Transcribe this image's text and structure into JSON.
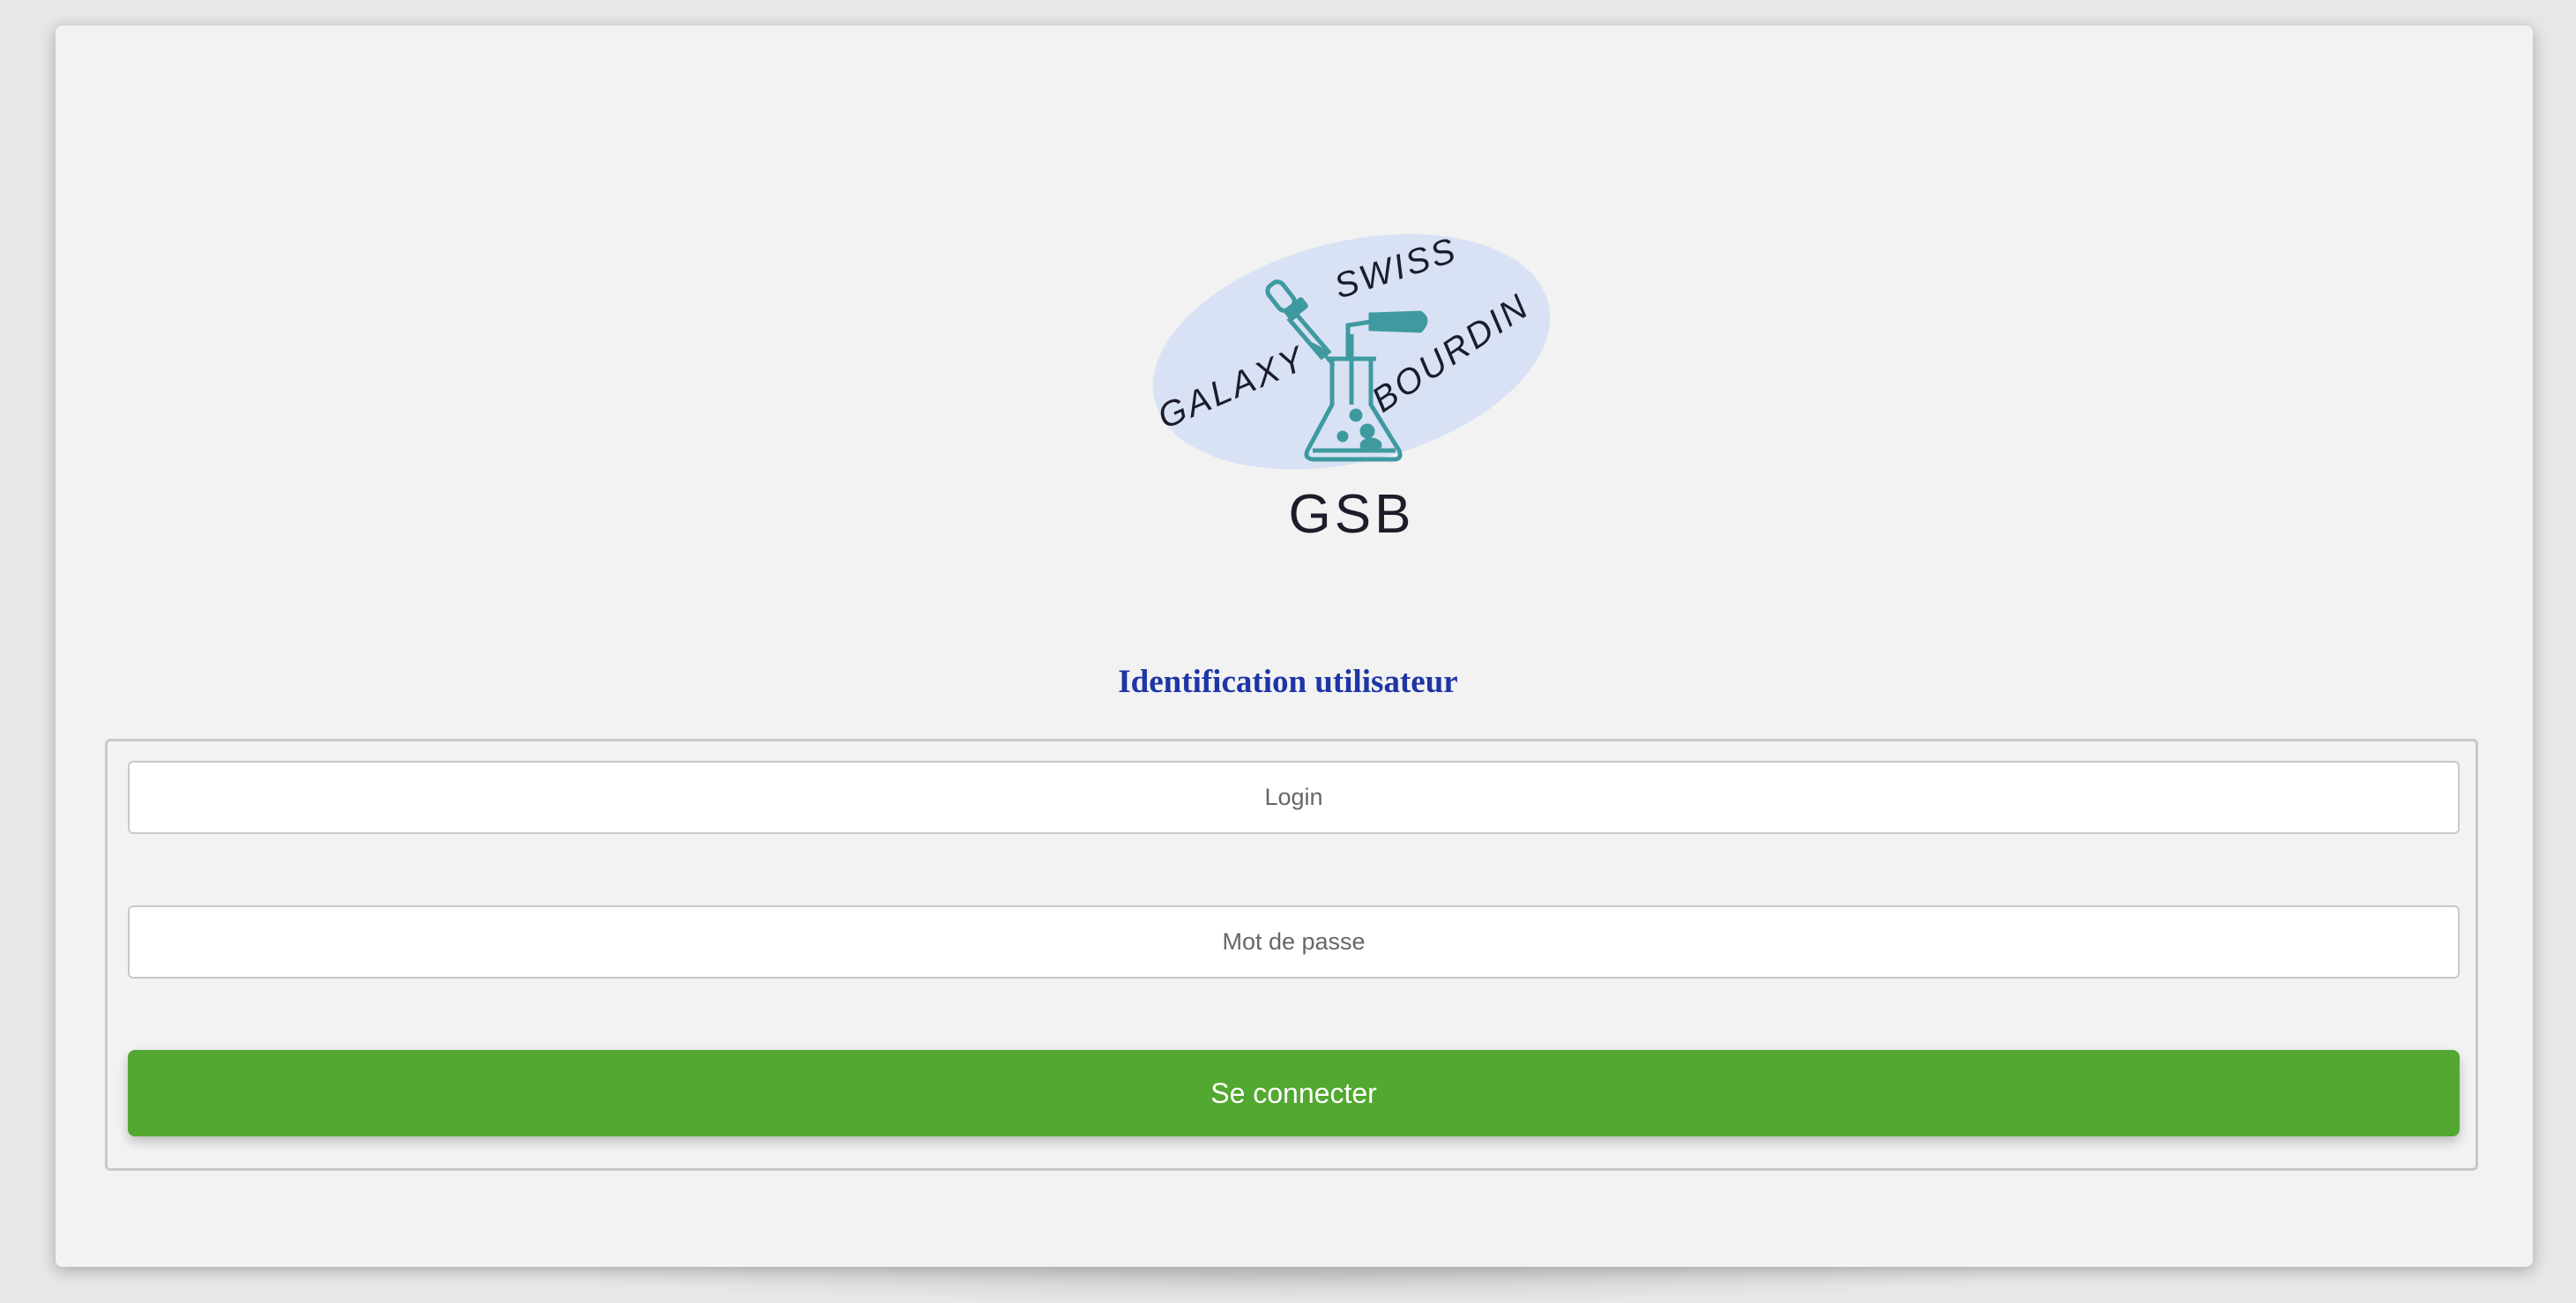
{
  "logo": {
    "ring_words": [
      "GALAXY",
      "SWISS",
      "BOURDIN"
    ],
    "acronym": "GSB",
    "colors": {
      "ellipse": "#d9e2f5",
      "instrument": "#3f9aa0",
      "text": "#1c1c2a"
    }
  },
  "form": {
    "title": "Identification utilisateur",
    "login_placeholder": "Login",
    "password_placeholder": "Mot de passe",
    "submit_label": "Se connecter"
  },
  "colors": {
    "title": "#1d35a6",
    "submit_button": "#52a830",
    "card_background": "#f2f2f2"
  }
}
